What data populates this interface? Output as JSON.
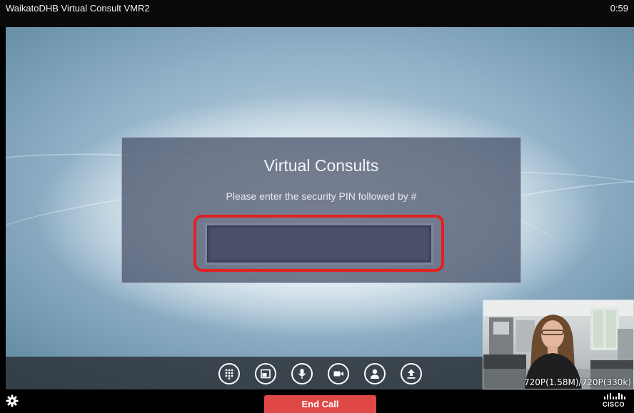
{
  "window": {
    "title": "WaikatoDHB Virtual Consult VMR2",
    "timer": "0:59"
  },
  "dialog": {
    "title": "Virtual Consults",
    "prompt": "Please enter the security PIN followed by #",
    "pin_value": "",
    "highlight_color": "#e41f1f"
  },
  "controls": [
    {
      "name": "keypad-button",
      "icon": "keypad-icon"
    },
    {
      "name": "layout-button",
      "icon": "layout-icon"
    },
    {
      "name": "microphone-button",
      "icon": "microphone-icon"
    },
    {
      "name": "camera-button",
      "icon": "camera-icon"
    },
    {
      "name": "participants-button",
      "icon": "person-icon"
    },
    {
      "name": "share-button",
      "icon": "upload-icon"
    }
  ],
  "selfview": {
    "stats": "720P(1.58M)/720P(330k)"
  },
  "footer": {
    "settings_icon": "gear-icon",
    "end_call_label": "End Call",
    "end_call_color": "#e04848",
    "logo_text": "CISCO"
  }
}
